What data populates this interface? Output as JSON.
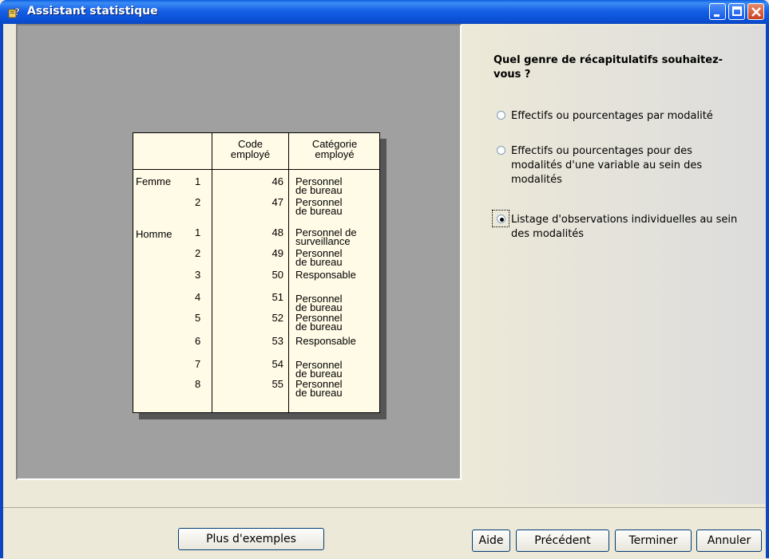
{
  "window": {
    "title": "Assistant statistique",
    "icons": [
      "app-icon",
      "minimize-icon",
      "maximize-icon",
      "close-icon"
    ]
  },
  "preview_table": {
    "headers": {
      "code": [
        "Code",
        "employé"
      ],
      "category": [
        "Catégorie",
        "employé"
      ]
    },
    "groups": [
      {
        "name": "Femme",
        "rows": [
          {
            "n": "1",
            "code": "46",
            "cat": [
              "Personnel",
              "de bureau"
            ]
          },
          {
            "n": "2",
            "code": "47",
            "cat": [
              "Personnel",
              "de bureau"
            ]
          }
        ]
      },
      {
        "name": "Homme",
        "rows": [
          {
            "n": "1",
            "code": "48",
            "cat": [
              "Personnel de",
              "surveillance"
            ]
          },
          {
            "n": "2",
            "code": "49",
            "cat": [
              "Personnel",
              "de bureau"
            ]
          },
          {
            "n": "3",
            "code": "50",
            "cat": [
              "Responsable"
            ]
          },
          {
            "n": "4",
            "code": "51",
            "cat": [
              "Personnel",
              "de bureau"
            ]
          },
          {
            "n": "5",
            "code": "52",
            "cat": [
              "Personnel",
              "de bureau"
            ]
          },
          {
            "n": "6",
            "code": "53",
            "cat": [
              "Responsable"
            ]
          },
          {
            "n": "7",
            "code": "54",
            "cat": [
              "Personnel",
              "de bureau"
            ]
          },
          {
            "n": "8",
            "code": "55",
            "cat": [
              "Personnel",
              "de bureau"
            ]
          }
        ]
      }
    ]
  },
  "question": "Quel genre de récapitulatifs souhaitez-vous ?",
  "options": [
    {
      "label": "Effectifs ou pourcentages par modalité",
      "selected": false
    },
    {
      "label": "Effectifs ou pourcentages pour des modalités d'une variable au sein des modalités",
      "selected": false
    },
    {
      "label": "Listage d'observations individuelles au sein des modalités",
      "selected": true
    }
  ],
  "buttons": {
    "more_examples": "Plus d'exemples",
    "help": "Aide",
    "previous": "Précédent",
    "finish": "Terminer",
    "cancel": "Annuler"
  },
  "colors": {
    "titlebar": "#0a4fd4",
    "preview_bg": "#a0a0a0",
    "table_bg": "#fffbe6"
  }
}
